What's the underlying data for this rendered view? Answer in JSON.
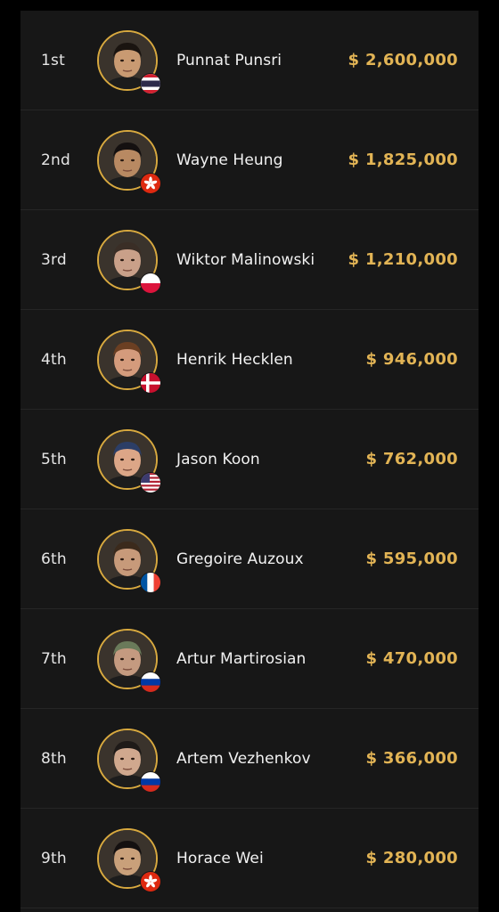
{
  "leaderboard": {
    "rows": [
      {
        "rank": "1st",
        "name": "Punnat Punsri",
        "prize": "$ 2,600,000",
        "flag": "thailand-flag",
        "skin": "#c99a72",
        "hair": "#1a1410"
      },
      {
        "rank": "2nd",
        "name": "Wayne Heung",
        "prize": "$ 1,825,000",
        "flag": "hong-kong-flag",
        "skin": "#b88962",
        "hair": "#141010"
      },
      {
        "rank": "3rd",
        "name": "Wiktor Malinowski",
        "prize": "$ 1,210,000",
        "flag": "poland-flag",
        "skin": "#c9a089",
        "hair": "#3a2e26"
      },
      {
        "rank": "4th",
        "name": "Henrik Hecklen",
        "prize": "$ 946,000",
        "flag": "denmark-flag",
        "skin": "#d49b7c",
        "hair": "#6b3f22"
      },
      {
        "rank": "5th",
        "name": "Jason Koon",
        "prize": "$ 762,000",
        "flag": "usa-flag",
        "skin": "#dca687",
        "hair": "#2c3e66"
      },
      {
        "rank": "6th",
        "name": "Gregoire Auzoux",
        "prize": "$ 595,000",
        "flag": "france-flag",
        "skin": "#c79a7a",
        "hair": "#3b2a1c"
      },
      {
        "rank": "7th",
        "name": "Artur Martirosian",
        "prize": "$ 470,000",
        "flag": "russia-flag",
        "skin": "#c49a80",
        "hair": "#6a7a5a"
      },
      {
        "rank": "8th",
        "name": "Artem Vezhenkov",
        "prize": "$ 366,000",
        "flag": "russia-flag",
        "skin": "#d0a88e",
        "hair": "#1e1a18"
      },
      {
        "rank": "9th",
        "name": "Horace Wei",
        "prize": "$ 280,000",
        "flag": "hong-kong-flag",
        "skin": "#c9a07a",
        "hair": "#141010"
      }
    ]
  },
  "colors": {
    "background": "#000000",
    "panel": "#171717",
    "accent_gold": "#e2b455",
    "avatar_ring": "#d8a93f",
    "text": "#f2f2f2"
  }
}
